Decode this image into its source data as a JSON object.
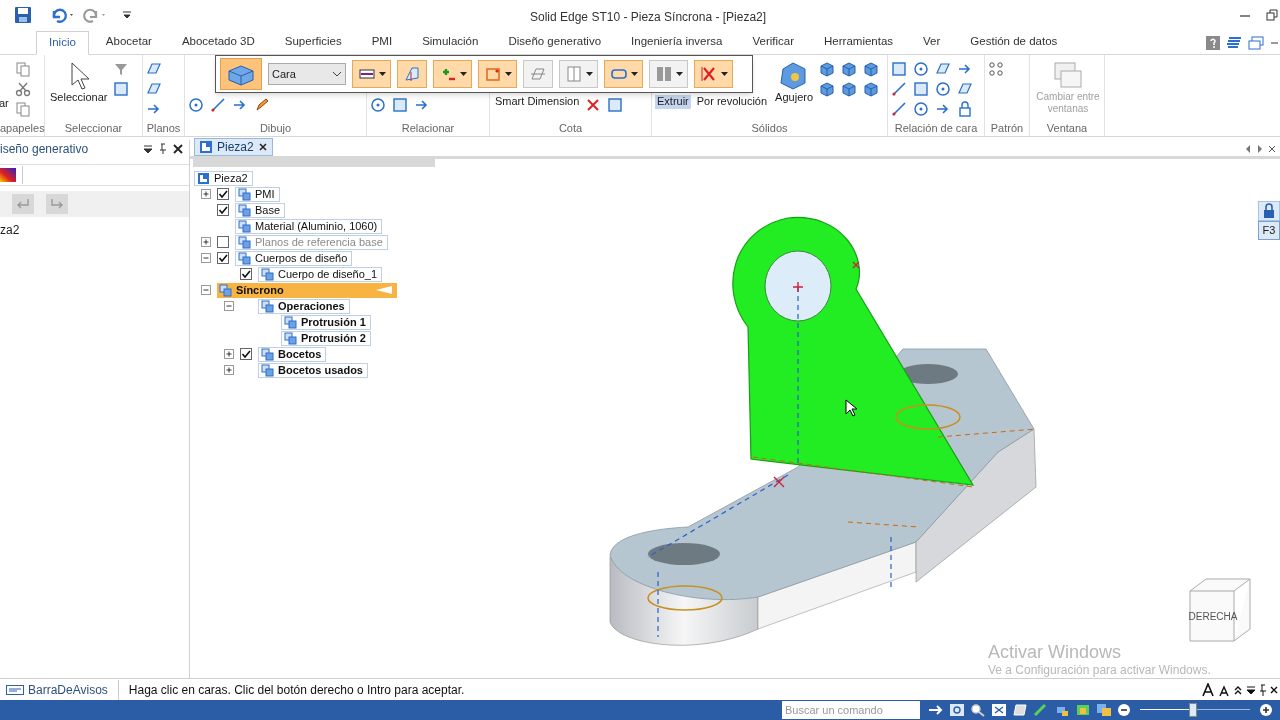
{
  "window": {
    "title": "Solid Edge ST10 - Pieza Síncrona - [Pieza2]"
  },
  "tabs": [
    {
      "label": "Inicio",
      "selected": true
    },
    {
      "label": "Abocetar",
      "selected": false
    },
    {
      "label": "Abocetado 3D",
      "selected": false
    },
    {
      "label": "Superficies",
      "selected": false
    },
    {
      "label": "PMI",
      "selected": false
    },
    {
      "label": "Simulación",
      "selected": false
    },
    {
      "label": "Diseño generativo",
      "selected": false
    },
    {
      "label": "Ingeniería inversa",
      "selected": false
    },
    {
      "label": "Verificar",
      "selected": false
    },
    {
      "label": "Herramientas",
      "selected": false
    },
    {
      "label": "Ver",
      "selected": false
    },
    {
      "label": "Gestión de datos",
      "selected": false
    }
  ],
  "ribbon": [
    {
      "label": "apapeles",
      "buttons": [
        {
          "label": "ar"
        }
      ]
    },
    {
      "label": "Seleccionar",
      "buttons": [
        {
          "label": "Seleccionar"
        }
      ]
    },
    {
      "label": "Planos"
    },
    {
      "label": "Dibujo"
    },
    {
      "label": "Relacionar"
    },
    {
      "label": "Cota",
      "buttons": [
        {
          "label": "Smart Dimension"
        }
      ]
    },
    {
      "label": "Sólidos",
      "buttons": [
        {
          "label": "Extruir",
          "selected": true
        },
        {
          "label": "Por revolución",
          "selected": false
        },
        {
          "label": "Agujero",
          "selected": false
        }
      ]
    },
    {
      "label": "Relación de cara"
    },
    {
      "label": "Patrón"
    },
    {
      "label": "Ventana",
      "buttons": [
        {
          "label": "Cambiar entre ventanas",
          "disabled": true
        }
      ]
    }
  ],
  "command_bar": {
    "selection_type": "Cara",
    "toggles": [
      {
        "on": true
      },
      {
        "on": true
      },
      {
        "on": true
      },
      {
        "on": true
      },
      {
        "on": false
      },
      {
        "on": false
      },
      {
        "on": true
      },
      {
        "on": false
      },
      {
        "on": true
      }
    ]
  },
  "side_panel": {
    "title": "iseño generativo",
    "item": "za2"
  },
  "document_tab": {
    "label": "Pieza2"
  },
  "tree": {
    "label": "Pieza2",
    "children": [
      {
        "label": "PMI",
        "expanded": false,
        "checked": true,
        "dimmed": false,
        "selected": false,
        "emphasized": false
      },
      {
        "label": "Base",
        "checked": true,
        "dimmed": false,
        "selected": false,
        "emphasized": false
      },
      {
        "label": "Material (Aluminio, 1060)",
        "dimmed": false,
        "selected": false,
        "emphasized": false
      },
      {
        "label": "Planos de referencia base",
        "expanded": false,
        "checked": false,
        "dimmed": true,
        "selected": false,
        "emphasized": false
      },
      {
        "label": "Cuerpos de diseño",
        "expanded": true,
        "checked": true,
        "dimmed": false,
        "selected": false,
        "emphasized": false,
        "children": [
          {
            "label": "Cuerpo de diseño_1",
            "checked": true,
            "dimmed": false,
            "selected": false,
            "emphasized": false
          }
        ]
      },
      {
        "label": "Síncrono",
        "expanded": true,
        "dimmed": false,
        "selected": true,
        "emphasized": true,
        "children": [
          {
            "label": "Operaciones",
            "expanded": true,
            "dimmed": false,
            "selected": false,
            "emphasized": true,
            "children": [
              {
                "label": "Protrusión 1",
                "dimmed": false,
                "selected": false,
                "emphasized": true
              },
              {
                "label": "Protrusión 2",
                "dimmed": false,
                "selected": false,
                "emphasized": true
              }
            ]
          },
          {
            "label": "Bocetos",
            "expanded": false,
            "checked": true,
            "dimmed": false,
            "selected": false,
            "emphasized": true
          },
          {
            "label": "Bocetos usados",
            "expanded": false,
            "dimmed": false,
            "selected": false,
            "emphasized": true
          }
        ]
      }
    ]
  },
  "view_cube": {
    "label": "DERECHA"
  },
  "shortcut_label": "F3",
  "windows_notice": {
    "title": "Activar Windows",
    "text": "Ve a Configuración para activar Windows."
  },
  "message_bar": {
    "label": "BarraDeAvisos",
    "message": "Haga clic en caras. Clic del botón derecho o Intro para aceptar."
  },
  "command_search": {
    "placeholder": "Buscar un comando"
  },
  "zoom_slider": {
    "level": 0.48
  }
}
